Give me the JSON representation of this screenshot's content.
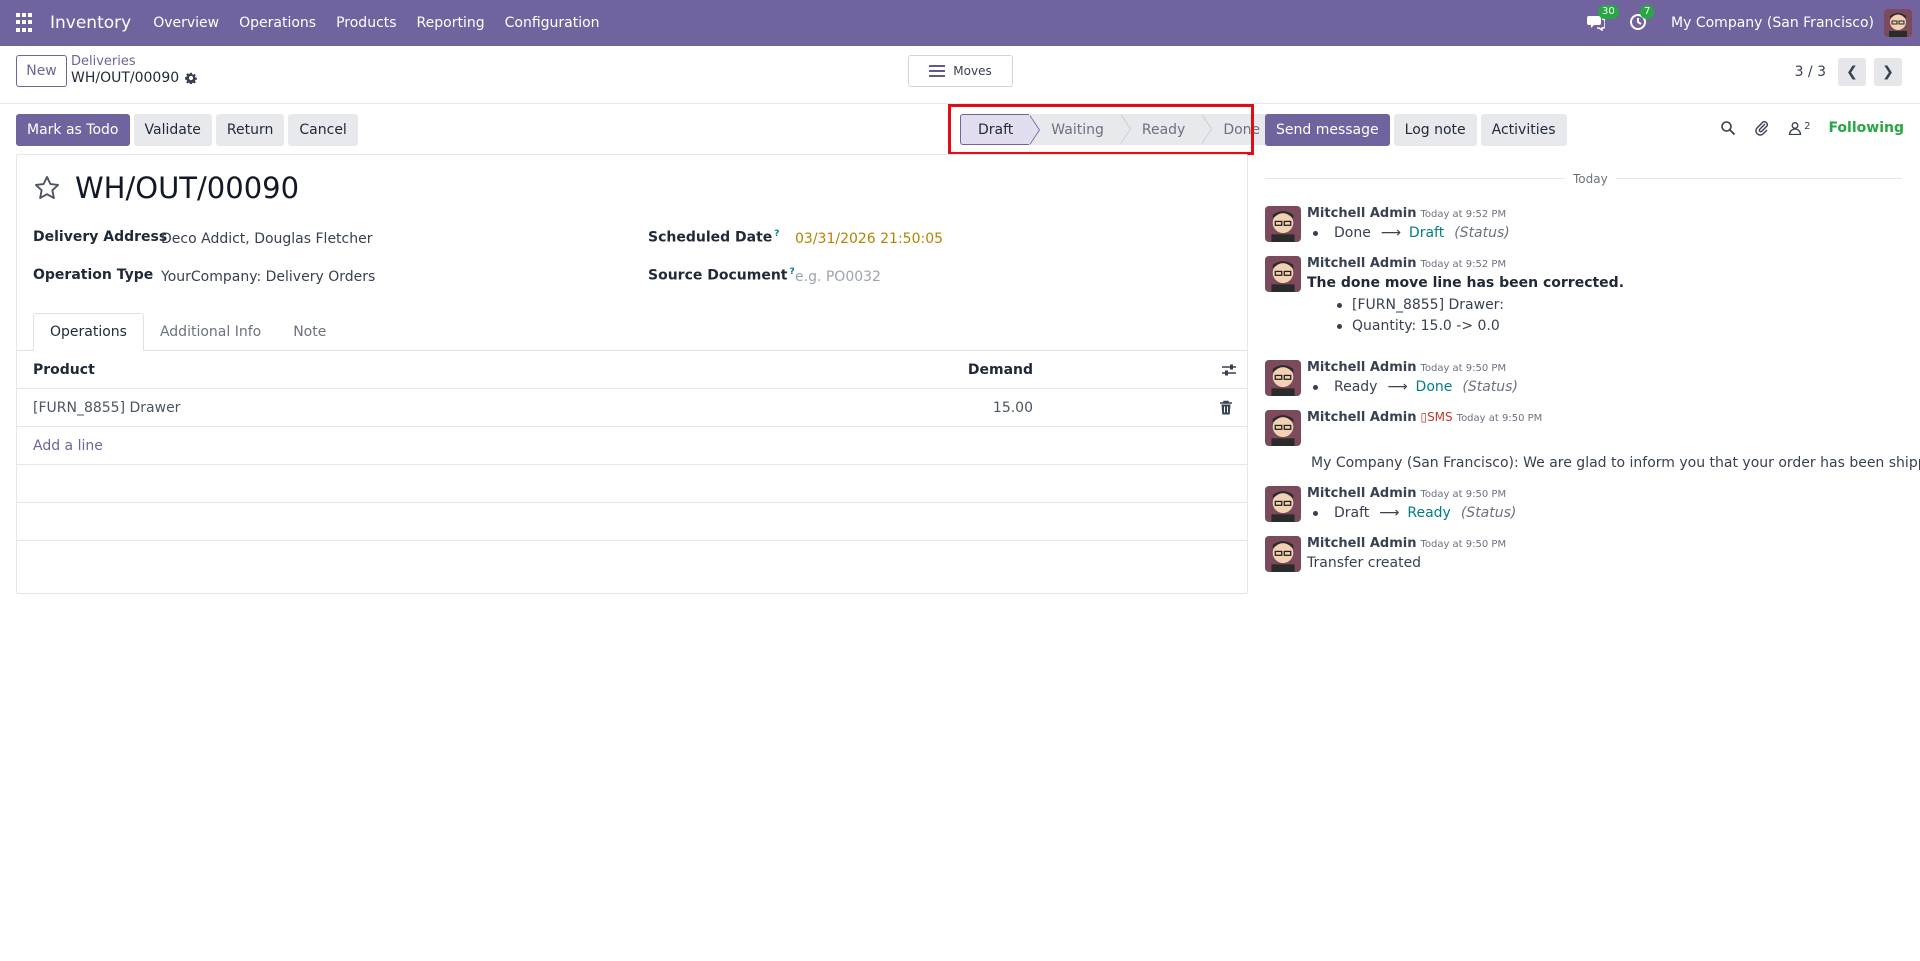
{
  "navbar": {
    "app_name": "Inventory",
    "menu": [
      "Overview",
      "Operations",
      "Products",
      "Reporting",
      "Configuration"
    ],
    "messages_count": "30",
    "activities_count": "7",
    "company": "My Company (San Francisco)"
  },
  "control_panel": {
    "new_label": "New",
    "breadcrumb_parent": "Deliveries",
    "breadcrumb_current": "WH/OUT/00090",
    "moves_label": "Moves",
    "pager": "3 / 3"
  },
  "actions": {
    "mark_todo": "Mark as Todo",
    "validate": "Validate",
    "return": "Return",
    "cancel": "Cancel"
  },
  "statusbar": {
    "stages": [
      "Draft",
      "Waiting",
      "Ready",
      "Done"
    ],
    "current": "Draft"
  },
  "form": {
    "title": "WH/OUT/00090",
    "delivery_address_label": "Delivery Address",
    "delivery_address": "Deco Addict, Douglas Fletcher",
    "operation_type_label": "Operation Type",
    "operation_type": "YourCompany: Delivery Orders",
    "scheduled_date_label": "Scheduled Date",
    "scheduled_date": "03/31/2026 21:50:05",
    "source_document_label": "Source Document",
    "source_document_placeholder": "e.g. PO0032",
    "help_mark": "?",
    "tabs": [
      "Operations",
      "Additional Info",
      "Note"
    ],
    "table": {
      "col_product": "Product",
      "col_demand": "Demand",
      "rows": [
        {
          "product": "[FURN_8855] Drawer",
          "demand": "15.00"
        }
      ],
      "add_line": "Add a line"
    }
  },
  "chatter": {
    "send_message": "Send message",
    "log_note": "Log note",
    "activities": "Activities",
    "followers_count": "2",
    "following": "Following",
    "date_separator": "Today",
    "messages": [
      {
        "author": "Mitchell Admin",
        "time": "Today at 9:52 PM",
        "old": "Done",
        "new": "Draft",
        "field": "(Status)"
      },
      {
        "author": "Mitchell Admin",
        "time": "Today at 9:52 PM",
        "text": "The done move line has been corrected.",
        "items": [
          "[FURN_8855] Drawer:",
          "Quantity: 15.0 -> 0.0"
        ]
      },
      {
        "author": "Mitchell Admin",
        "time": "Today at 9:50 PM",
        "old": "Ready",
        "new": "Done",
        "field": "(Status)"
      },
      {
        "author": "Mitchell Admin",
        "sms": "SMS",
        "time": "Today at 9:50 PM",
        "text": "My Company (San Francisco): We are glad to inform you that your order has been shipped."
      },
      {
        "author": "Mitchell Admin",
        "time": "Today at 9:50 PM",
        "old": "Draft",
        "new": "Ready",
        "field": "(Status)"
      },
      {
        "author": "Mitchell Admin",
        "time": "Today at 9:50 PM",
        "text": "Transfer created"
      }
    ]
  },
  "colors": {
    "brand": "#71639e",
    "highlight": "#e30b17",
    "following": "#28a745",
    "link_teal": "#017e84",
    "date_amber": "#b58300"
  },
  "icons": {
    "apps": "apps-grid-icon",
    "messages": "chat-icon",
    "activities": "clock-icon",
    "gear": "gear-icon",
    "moves": "hamburger-icon",
    "star": "star-icon",
    "settings": "sliders-icon",
    "trash": "trash-icon",
    "search": "search-icon",
    "attach": "paperclip-icon",
    "followers": "user-icon"
  }
}
